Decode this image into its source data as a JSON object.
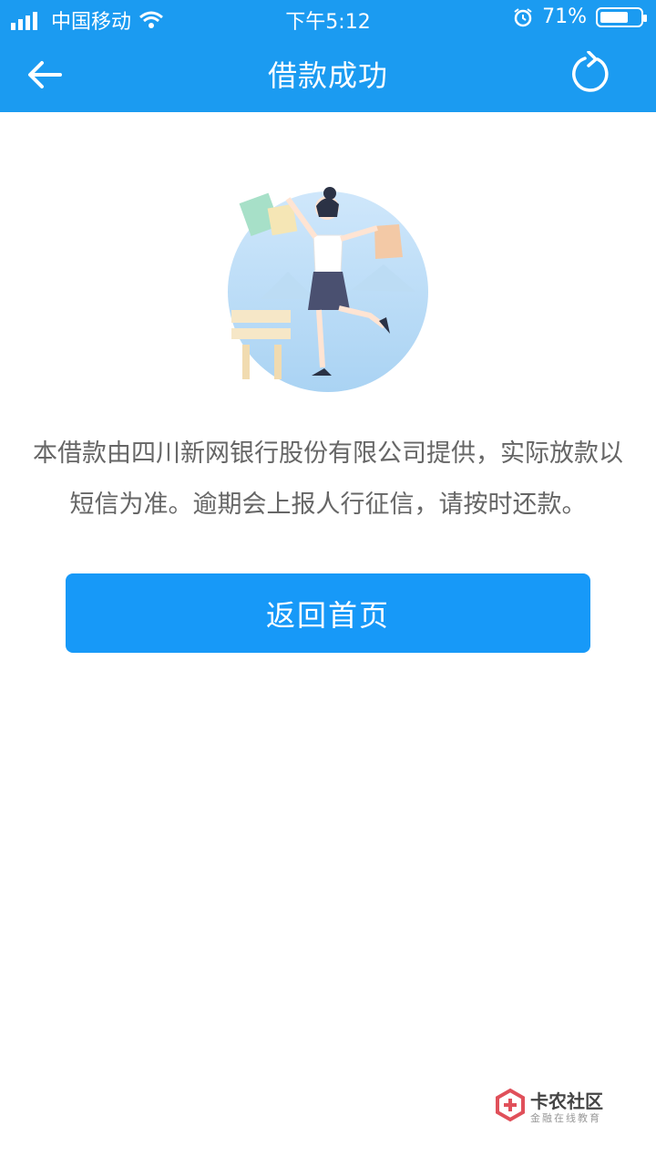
{
  "status_bar": {
    "carrier": "中国移动",
    "time": "下午5:12",
    "battery_percent": "71%",
    "battery_level": 0.71
  },
  "nav": {
    "title": "借款成功",
    "back_icon": "arrow-left-icon",
    "refresh_icon": "refresh-icon"
  },
  "main": {
    "message_line1": "本借款由四川新网银行股份有限公司提供，实际放款以",
    "message_line2": "短信为准。逾期会上报人行征信，请按时还款。",
    "button_label": "返回首页"
  },
  "watermark": {
    "title": "卡农社区",
    "subtitle": "金融在线教育"
  },
  "colors": {
    "header": "#1b9bf1",
    "button": "#1799f8",
    "text_secondary": "#666666"
  }
}
